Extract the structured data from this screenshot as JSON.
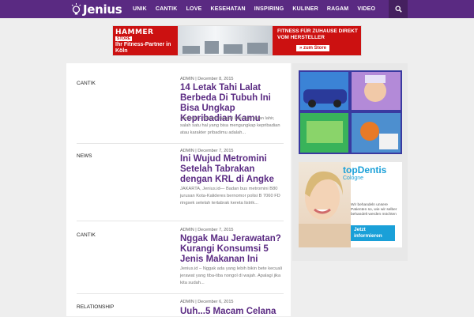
{
  "site": {
    "logo": "Jenius"
  },
  "nav": {
    "items": [
      "UNIK",
      "CANTIK",
      "LOVE",
      "KESEHATAN",
      "INSPIRING",
      "KULINER",
      "RAGAM",
      "VIDEO"
    ]
  },
  "banner": {
    "brand": "HAMMER",
    "store_tag": "STORE",
    "partner_text": "Ihr Fitness-Partner in Köln",
    "headline": "FITNESS FÜR ZUHAUSE DIREKT VOM HERSTELLER",
    "cta": "» zum Store"
  },
  "articles": [
    {
      "category": "CANTIK",
      "meta": "ADMIN | December 8, 2015",
      "title": "14 Letak Tahi Lalat Berbeda Di Tubuh Ini Bisa Ungkap Kepribadian Kamu",
      "excerpt": "Jenius.id – Seperti tanggal lahir dan bulan lahir, salah satu hal yang bisa mengungkap kepribadian atau karakter pribadimu adalah..."
    },
    {
      "category": "NEWS",
      "meta": "ADMIN | December 7, 2015",
      "title": "Ini Wujud Metromini Setelah Tabrakan dengan KRL di Angke",
      "excerpt": "JAKARTA, Jenius.id— Badan bus metromini B80 jurusan Kota-Kalideres bernomor polisi B 7060 FD ringsek setelah tertabrak kereta listrik..."
    },
    {
      "category": "CANTIK",
      "meta": "ADMIN | December 7, 2015",
      "title": "Nggak Mau Jerawatan? Kurangi Konsumsi 5 Jenis Makanan Ini",
      "excerpt": "Jenius.id – Nggak ada yang lebih bikin bete kecuali jerawat yang tiba-tiba nongol di wajah. Apalagi jika kita sudah..."
    },
    {
      "category": "RELATIONSHIP",
      "meta": "ADMIN | December 6, 2015",
      "title": "Uuh...5 Macam Celana",
      "excerpt": ""
    }
  ],
  "sidebar_ads": {
    "dentis_logo": "topDentis",
    "dentis_sub": "Cologne",
    "dentis_text": "Wir behandeln unsere Patienten so, wie wir selber behandelt werden möchten",
    "dentis_cta": "Jetzt informieren"
  },
  "colors": {
    "brand": "#5a2a82",
    "nav_dark": "#45205f",
    "ad_red": "#cc1111",
    "dentis_blue": "#1aa0d8"
  }
}
